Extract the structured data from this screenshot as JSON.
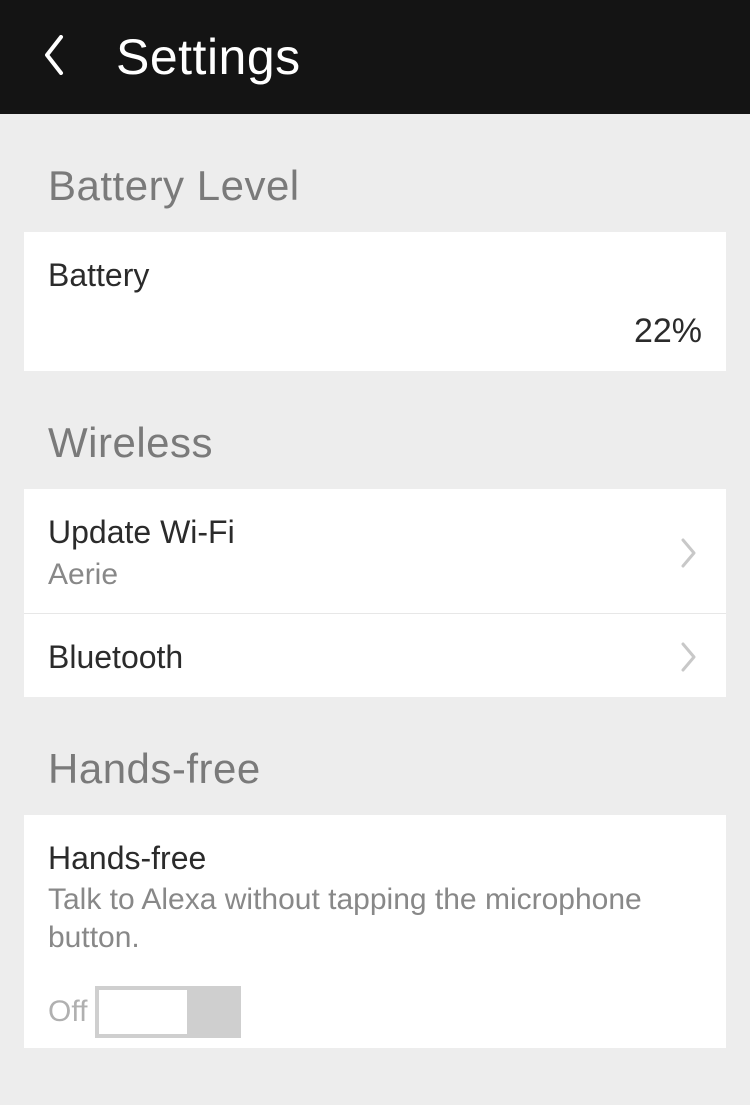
{
  "header": {
    "title": "Settings"
  },
  "sections": {
    "battery": {
      "heading": "Battery Level",
      "label": "Battery",
      "value": "22%"
    },
    "wireless": {
      "heading": "Wireless",
      "wifi": {
        "label": "Update Wi-Fi",
        "value": "Aerie"
      },
      "bluetooth": {
        "label": "Bluetooth"
      }
    },
    "handsfree": {
      "heading": "Hands-free",
      "title": "Hands-free",
      "desc": "Talk to Alexa without tapping the microphone button.",
      "state_label": "Off"
    }
  }
}
